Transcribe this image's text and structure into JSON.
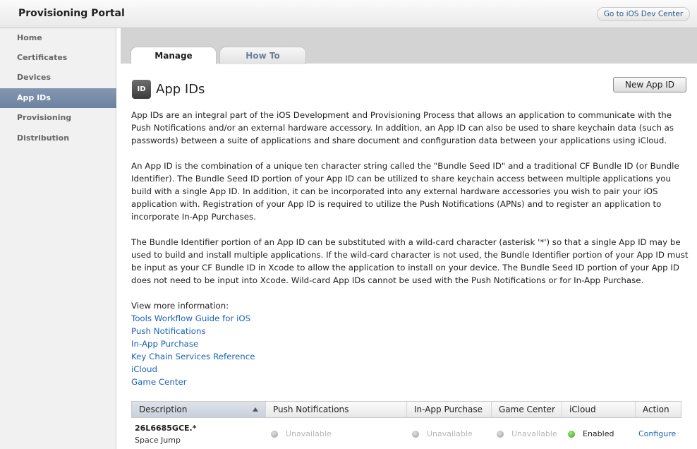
{
  "header": {
    "title": "Provisioning Portal",
    "dev_center_label": "Go to iOS Dev Center"
  },
  "sidebar": {
    "items": [
      {
        "label": "Home"
      },
      {
        "label": "Certificates"
      },
      {
        "label": "Devices"
      },
      {
        "label": "App IDs",
        "active": true
      },
      {
        "label": "Provisioning"
      },
      {
        "label": "Distribution"
      }
    ]
  },
  "tabs": [
    {
      "label": "Manage",
      "active": true
    },
    {
      "label": "How To"
    }
  ],
  "page": {
    "icon_text": "ID",
    "title": "App IDs",
    "new_button": "New App ID",
    "paragraphs": [
      "App IDs are an integral part of the iOS Development and Provisioning Process that allows an application to communicate with the Push Notifications and/or an external hardware accessory. In addition, an App ID can also be used to share keychain data (such as passwords) between a suite of applications and share document and configuration data between your applications using iCloud.",
      "An App ID is the combination of a unique ten character string called the \"Bundle Seed ID\" and a traditional CF Bundle ID (or Bundle Identifier). The Bundle Seed ID portion of your App ID can be utilized to share keychain access between multiple applications you build with a single App ID. In addition, it can be incorporated into any external hardware accessories you wish to pair your iOS application with. Registration of your App ID is required to utilize the Push Notifications (APNs) and to register an application to incorporate In-App Purchases.",
      "The Bundle Identifier portion of an App ID can be substituted with a wild-card character (asterisk '*') so that a single App ID may be used to build and install multiple applications. If the wild-card character is not used, the Bundle Identifier portion of your App ID must be input as your CF Bundle ID in Xcode to allow the application to install on your device. The Bundle Seed ID portion of your App ID does not need to be input into Xcode. Wild-card App IDs cannot be used with the Push Notifications or for In-App Purchase."
    ],
    "more_info_label": "View more information:",
    "links": [
      "Tools Workflow Guide for iOS",
      "Push Notifications",
      "In-App Purchase",
      "Key Chain Services Reference",
      "iCloud",
      "Game Center"
    ]
  },
  "table": {
    "headers": [
      "Description",
      "Push Notifications",
      "In-App Purchase",
      "Game Center",
      "iCloud",
      "Action"
    ],
    "rows": [
      {
        "id": "26L6685GCE.*",
        "name": "Space Jump",
        "push": "Unavailable",
        "iap": "Unavailable",
        "game_center": "Unavailable",
        "icloud": "Enabled",
        "action": "Configure"
      }
    ]
  },
  "colors": {
    "accent_link": "#1a64b4",
    "sidebar_active": "#7489a7",
    "enabled_dot": "#2e9a15",
    "unavailable_dot": "#9c9c9c"
  }
}
